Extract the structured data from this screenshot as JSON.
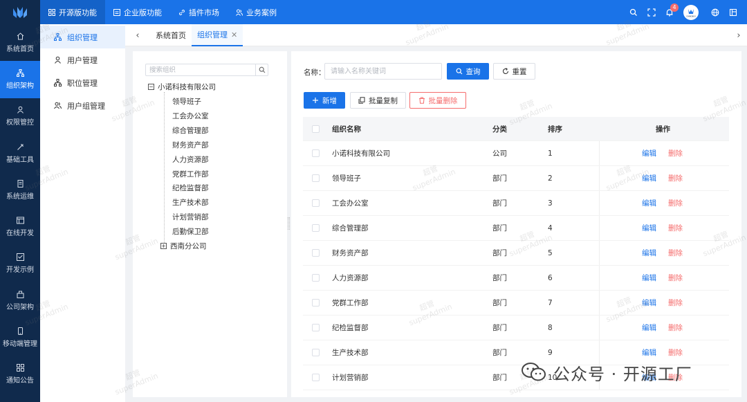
{
  "topnav": {
    "items": [
      {
        "label": "开源版功能",
        "icon": "grid-icon"
      },
      {
        "label": "企业版功能",
        "icon": "window-icon"
      },
      {
        "label": "插件市场",
        "icon": "link-icon"
      },
      {
        "label": "业务案例",
        "icon": "people-icon"
      }
    ],
    "notification_count": "4",
    "avatar_text": "CHINOBUS"
  },
  "sidebar": {
    "items": [
      {
        "label": "系统首页",
        "icon": "home-icon"
      },
      {
        "label": "组织架构",
        "icon": "org-icon"
      },
      {
        "label": "权限管控",
        "icon": "user-icon"
      },
      {
        "label": "基础工具",
        "icon": "tool-icon"
      },
      {
        "label": "系统运维",
        "icon": "doc-icon"
      },
      {
        "label": "在线开发",
        "icon": "code-icon"
      },
      {
        "label": "开发示例",
        "icon": "example-icon"
      },
      {
        "label": "公司架构",
        "icon": "company-icon"
      },
      {
        "label": "移动端管理",
        "icon": "mobile-icon"
      },
      {
        "label": "通知公告",
        "icon": "notice-icon"
      }
    ]
  },
  "submenu": {
    "items": [
      {
        "label": "组织管理",
        "icon": "org-icon"
      },
      {
        "label": "用户管理",
        "icon": "user-icon"
      },
      {
        "label": "职位管理",
        "icon": "position-icon"
      },
      {
        "label": "用户组管理",
        "icon": "group-icon"
      }
    ]
  },
  "tabs": {
    "items": [
      {
        "label": "系统首页"
      },
      {
        "label": "组织管理"
      }
    ]
  },
  "tree": {
    "search_placeholder": "搜索组织",
    "root": "小诺科技有限公司",
    "children": [
      "领导班子",
      "工会办公室",
      "综合管理部",
      "财务资产部",
      "人力资源部",
      "党群工作部",
      "纪检监督部",
      "生产技术部",
      "计划营销部",
      "后勤保卫部",
      "西南分公司"
    ]
  },
  "filter": {
    "name_label": "名称：",
    "name_placeholder": "请输入名称关键词",
    "query_label": "查询",
    "reset_label": "重置"
  },
  "actions": {
    "add_label": "新增",
    "copy_label": "批量复制",
    "delete_label": "批量删除"
  },
  "table": {
    "headers": {
      "name": "组织名称",
      "type": "分类",
      "order": "排序",
      "ops": "操作"
    },
    "edit_label": "编辑",
    "delete_label": "删除",
    "rows": [
      {
        "name": "小诺科技有限公司",
        "type": "公司",
        "order": "1"
      },
      {
        "name": "领导班子",
        "type": "部门",
        "order": "2"
      },
      {
        "name": "工会办公室",
        "type": "部门",
        "order": "3"
      },
      {
        "name": "综合管理部",
        "type": "部门",
        "order": "4"
      },
      {
        "name": "财务资产部",
        "type": "部门",
        "order": "5"
      },
      {
        "name": "人力资源部",
        "type": "部门",
        "order": "6"
      },
      {
        "name": "党群工作部",
        "type": "部门",
        "order": "7"
      },
      {
        "name": "纪检监督部",
        "type": "部门",
        "order": "8"
      },
      {
        "name": "生产技术部",
        "type": "部门",
        "order": "9"
      },
      {
        "name": "计划营销部",
        "type": "部门",
        "order": "10"
      }
    ]
  },
  "watermark": {
    "line1": "超管",
    "line2": "superAdmin"
  },
  "brand": {
    "text": "公众号 · 开源工厂"
  },
  "colors": {
    "primary": "#1a73e8",
    "sidebar": "#102a4c",
    "danger": "#f56c6c"
  }
}
